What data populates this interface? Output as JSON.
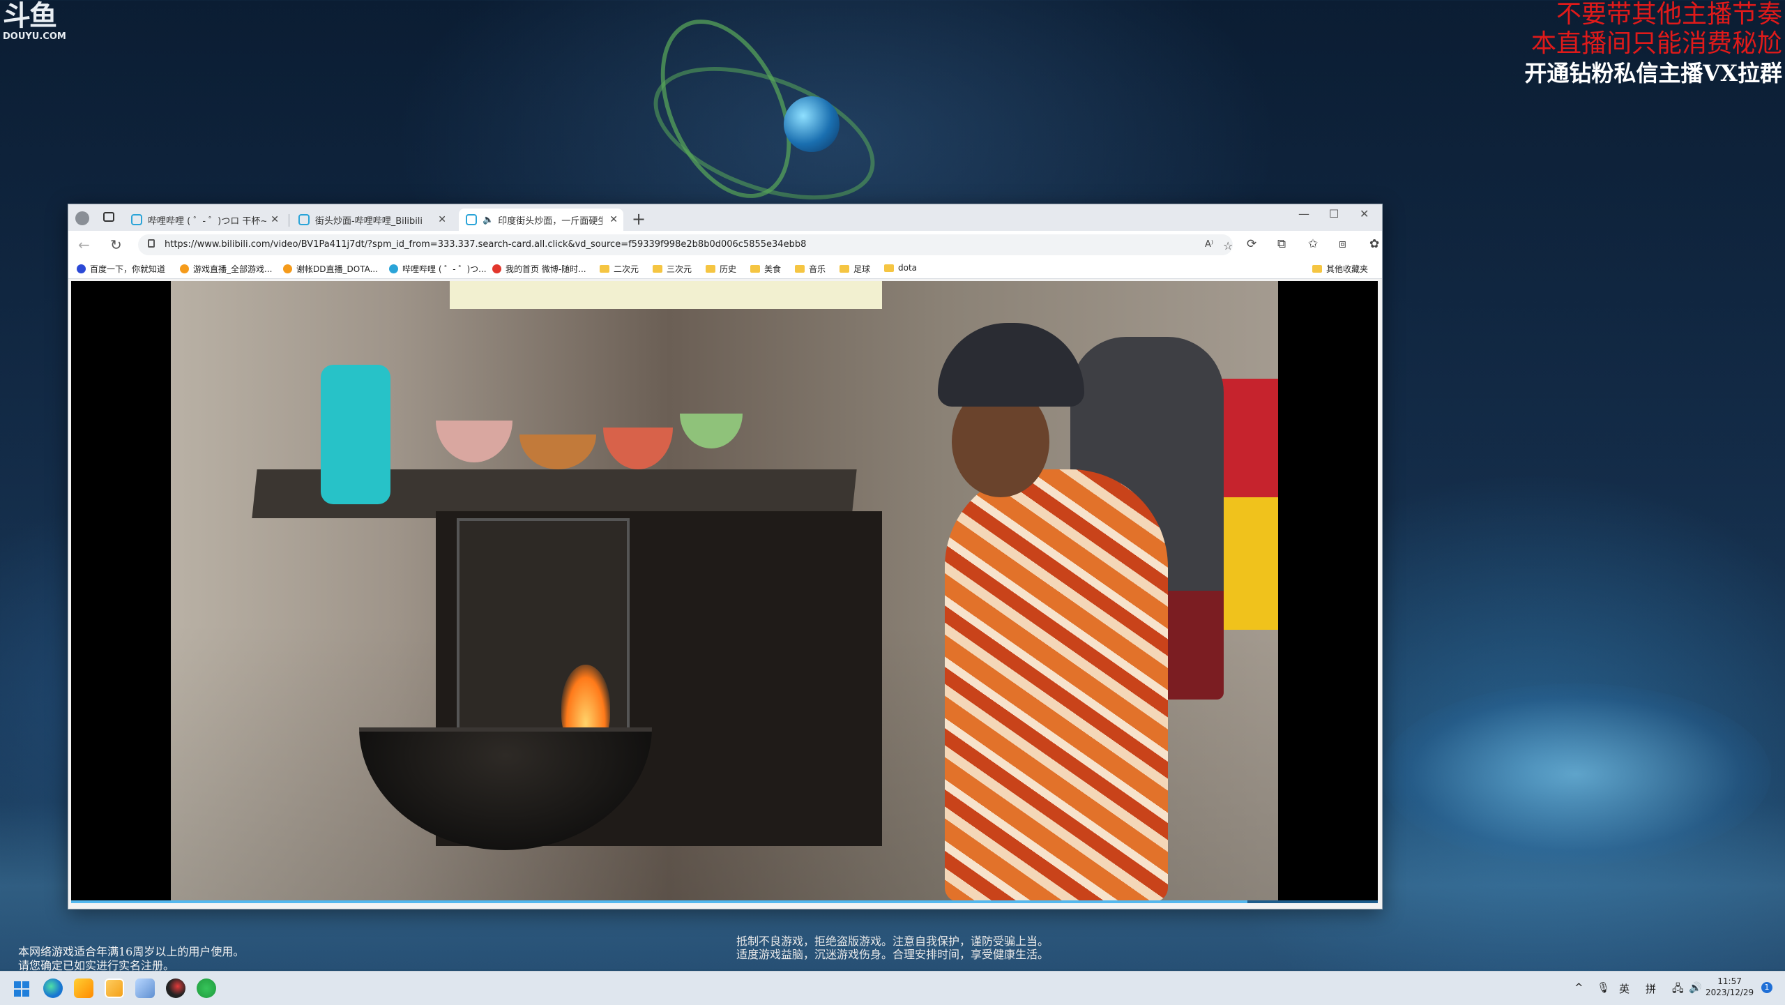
{
  "overlay": {
    "logo_cn": "斗鱼",
    "logo_en": "DOUYU.COM",
    "line1": "不要带其他主播节奏",
    "line2": "本直播间只能消费秘尬",
    "line3": "开通钻粉私信主播VX拉群"
  },
  "browser": {
    "tabs": [
      {
        "title": "哔哩哔哩 ( ゜- ゜)つロ 干杯~-bilibili"
      },
      {
        "title": "街头炒面-哔哩哔哩_Bilibili"
      },
      {
        "title": "印度街头炒面，一斤面硬生生"
      }
    ],
    "window_controls": {
      "minimize": "—",
      "maximize": "☐",
      "close": "✕"
    },
    "url": "https://www.bilibili.com/video/BV1Pa411j7dt/?spm_id_from=333.337.search-card.all.click&vd_source=f59339f998e2b8b0d006c5855e34ebb8",
    "favorites": [
      {
        "label": "百度一下，你就知道"
      },
      {
        "label": "游戏直播_全部游戏..."
      },
      {
        "label": "谢帐DD直播_DOTA..."
      },
      {
        "label": "哔哩哔哩 ( ゜- ゜)つ..."
      },
      {
        "label": "我的首页 微博-随时..."
      },
      {
        "label": "二次元"
      },
      {
        "label": "三次元"
      },
      {
        "label": "历史"
      },
      {
        "label": "美食"
      },
      {
        "label": "音乐"
      },
      {
        "label": "足球"
      },
      {
        "label": "dota"
      }
    ],
    "other_favorites": "其他收藏夹",
    "video_progress": 0.9
  },
  "notices": {
    "left_1": "本网络游戏适合年满16周岁以上的用户使用。",
    "left_2": "请您确定已如实进行实名注册。",
    "center_1": "抵制不良游戏，拒绝盗版游戏。注意自我保护，谨防受骗上当。",
    "center_2": "适度游戏益脑，沉迷游戏伤身。合理安排时间，享受健康生活。"
  },
  "taskbar": {
    "ime_lang": "英",
    "ime_mode": "拼",
    "time": "11:57",
    "date": "2023/12/29",
    "notification_count": "1"
  },
  "colors": {
    "overlay_red": "#e01a1a",
    "tab_icon": "#2aa4d8",
    "progress": "#54b8ef"
  }
}
